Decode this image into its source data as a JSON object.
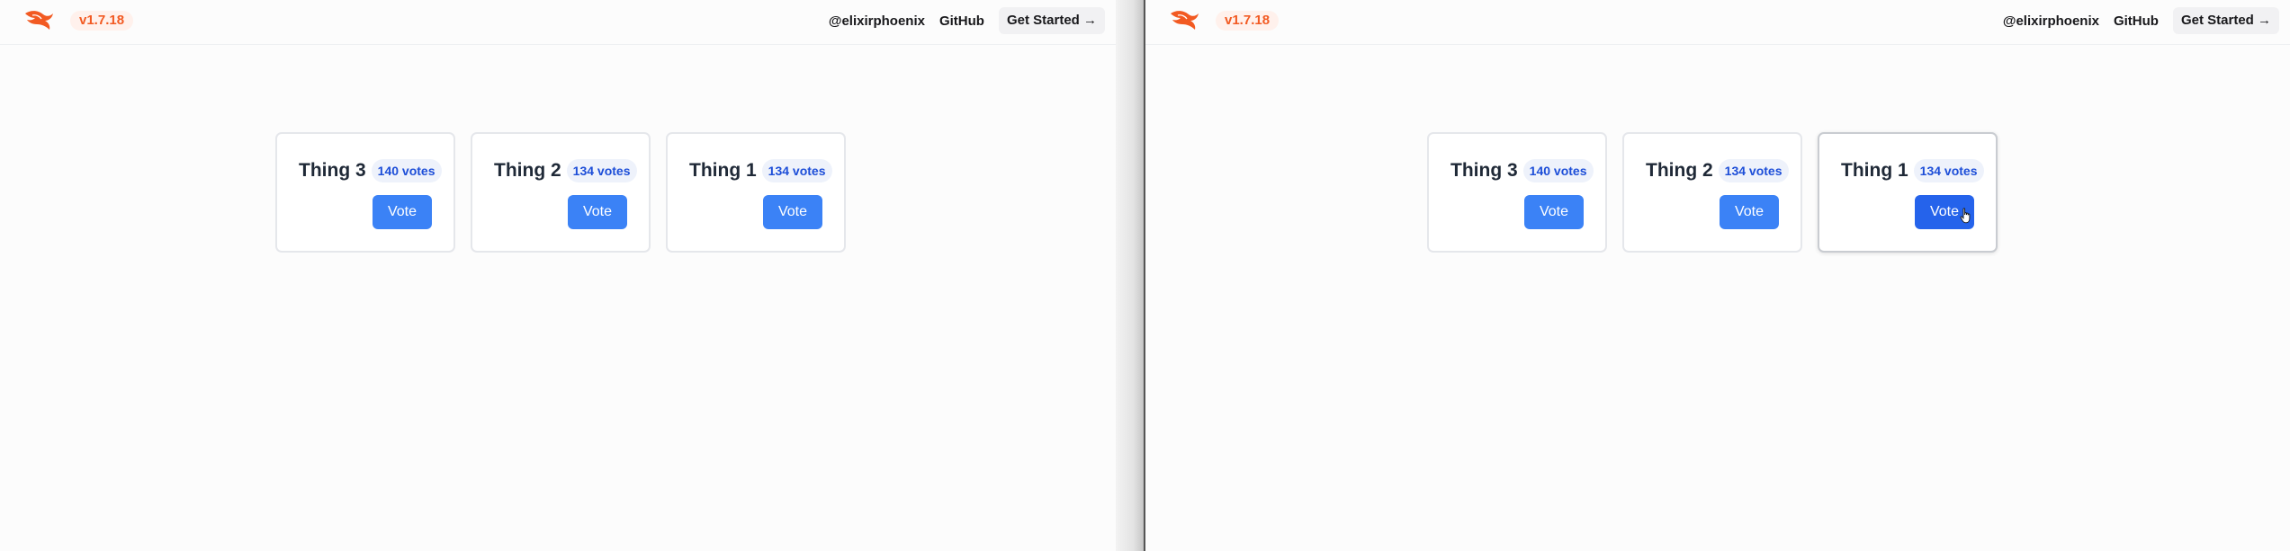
{
  "colors": {
    "brand": "#f25a22",
    "primary_button": "#3b82f6",
    "primary_button_hover": "#2563eb",
    "badge_text": "#1d4ed8"
  },
  "panels": [
    {
      "header": {
        "logo_icon": "phoenix-logo-icon",
        "version": "v1.7.18",
        "nav": {
          "twitter": "@elixirphoenix",
          "github": "GitHub",
          "get_started": "Get Started →"
        }
      },
      "cards": [
        {
          "title": "Thing 3",
          "votes": "140 votes",
          "button": "Vote"
        },
        {
          "title": "Thing 2",
          "votes": "134 votes",
          "button": "Vote"
        },
        {
          "title": "Thing 1",
          "votes": "134 votes",
          "button": "Vote"
        }
      ]
    },
    {
      "header": {
        "logo_icon": "phoenix-logo-icon",
        "version": "v1.7.18",
        "nav": {
          "twitter": "@elixirphoenix",
          "github": "GitHub",
          "get_started": "Get Started →"
        }
      },
      "cards": [
        {
          "title": "Thing 3",
          "votes": "140 votes",
          "button": "Vote"
        },
        {
          "title": "Thing 2",
          "votes": "134 votes",
          "button": "Vote"
        },
        {
          "title": "Thing 1",
          "votes": "134 votes",
          "button": "Vote",
          "hovered": true,
          "cursor_icon": "hand-pointer-icon"
        }
      ]
    }
  ]
}
